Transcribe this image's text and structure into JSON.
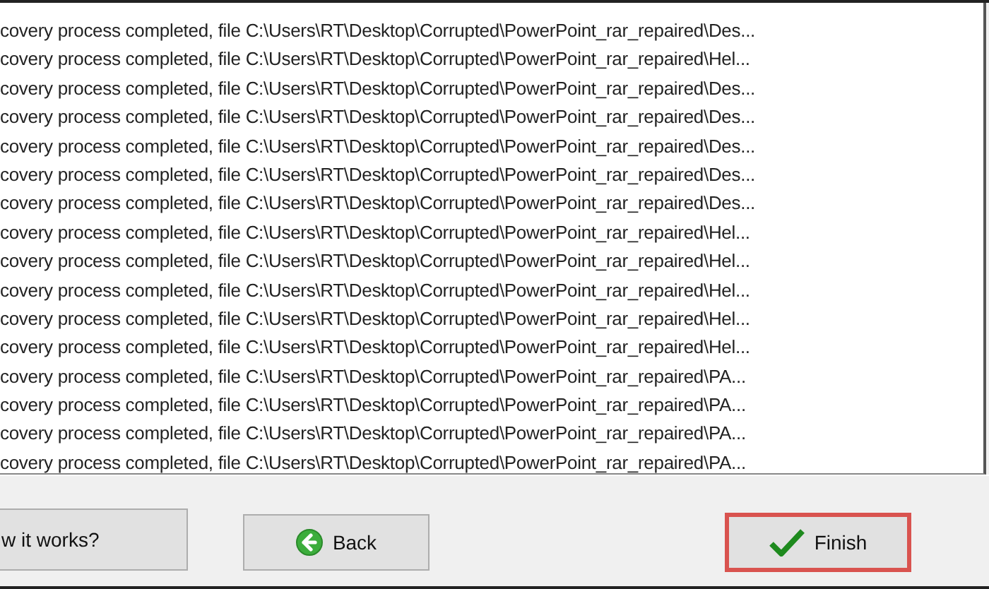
{
  "log": {
    "lines": [
      "covery process completed, file C:\\Users\\RT\\Desktop\\Corrupted\\PowerPoint_rar_repaired\\Des...",
      "covery process completed, file C:\\Users\\RT\\Desktop\\Corrupted\\PowerPoint_rar_repaired\\Hel...",
      "covery process completed, file C:\\Users\\RT\\Desktop\\Corrupted\\PowerPoint_rar_repaired\\Des...",
      "covery process completed, file C:\\Users\\RT\\Desktop\\Corrupted\\PowerPoint_rar_repaired\\Des...",
      "covery process completed, file C:\\Users\\RT\\Desktop\\Corrupted\\PowerPoint_rar_repaired\\Des...",
      "covery process completed, file C:\\Users\\RT\\Desktop\\Corrupted\\PowerPoint_rar_repaired\\Des...",
      "covery process completed, file C:\\Users\\RT\\Desktop\\Corrupted\\PowerPoint_rar_repaired\\Des...",
      "covery process completed, file C:\\Users\\RT\\Desktop\\Corrupted\\PowerPoint_rar_repaired\\Hel...",
      "covery process completed, file C:\\Users\\RT\\Desktop\\Corrupted\\PowerPoint_rar_repaired\\Hel...",
      "covery process completed, file C:\\Users\\RT\\Desktop\\Corrupted\\PowerPoint_rar_repaired\\Hel...",
      "covery process completed, file C:\\Users\\RT\\Desktop\\Corrupted\\PowerPoint_rar_repaired\\Hel...",
      "covery process completed, file C:\\Users\\RT\\Desktop\\Corrupted\\PowerPoint_rar_repaired\\Hel...",
      "covery process completed, file C:\\Users\\RT\\Desktop\\Corrupted\\PowerPoint_rar_repaired\\PA...",
      "covery process completed, file C:\\Users\\RT\\Desktop\\Corrupted\\PowerPoint_rar_repaired\\PA...",
      "covery process completed, file C:\\Users\\RT\\Desktop\\Corrupted\\PowerPoint_rar_repaired\\PA...",
      "covery process completed, file C:\\Users\\RT\\Desktop\\Corrupted\\PowerPoint_rar_repaired\\PA..."
    ]
  },
  "buttons": [
    {
      "kind": "help",
      "label": "w it works?",
      "highlighted": false
    },
    {
      "kind": "back",
      "label": "Back",
      "highlighted": false
    },
    {
      "kind": "finish",
      "label": "Finish",
      "highlighted": true
    }
  ]
}
